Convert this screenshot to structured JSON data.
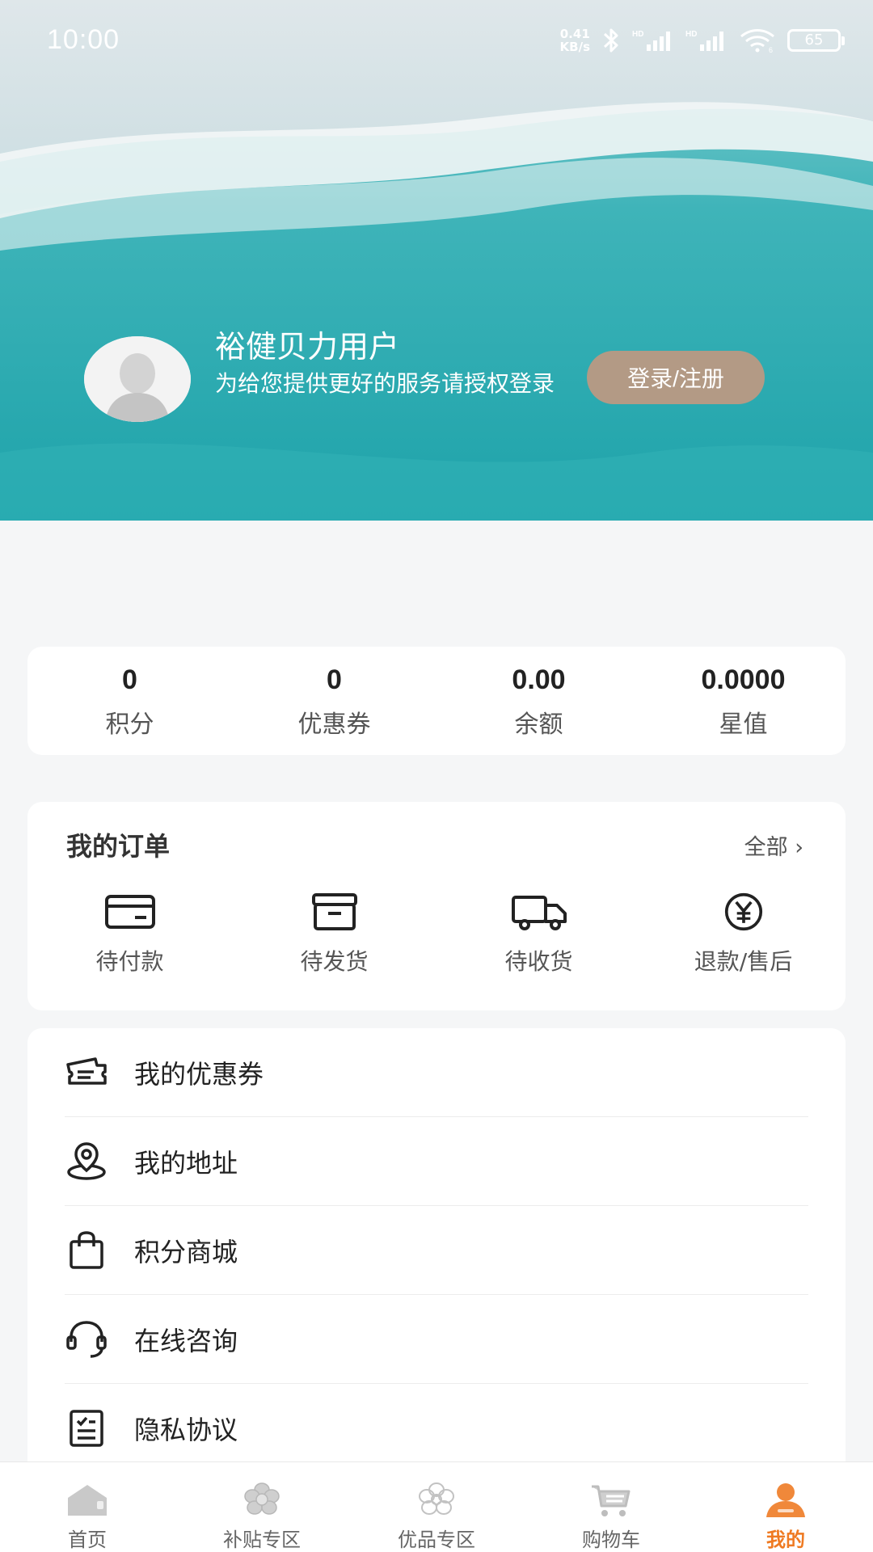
{
  "status_bar": {
    "time": "10:00",
    "net_speed_value": "0.41",
    "net_speed_unit": "KB/s",
    "battery": "65"
  },
  "profile": {
    "name": "裕健贝力用户",
    "desc": "为给您提供更好的服务请授权登录",
    "login_label": "登录/注册"
  },
  "stats": [
    {
      "value": "0",
      "label": "积分"
    },
    {
      "value": "0",
      "label": "优惠券"
    },
    {
      "value": "0.00",
      "label": "余额"
    },
    {
      "value": "0.0000",
      "label": "星值"
    }
  ],
  "orders": {
    "title": "我的订单",
    "all_label": "全部 ›",
    "items": [
      {
        "label": "待付款",
        "icon": "card-icon"
      },
      {
        "label": "待发货",
        "icon": "box-icon"
      },
      {
        "label": "待收货",
        "icon": "truck-icon"
      },
      {
        "label": "退款/售后",
        "icon": "yuan-icon"
      }
    ]
  },
  "menu": [
    {
      "label": "我的优惠券",
      "icon": "ticket-icon"
    },
    {
      "label": "我的地址",
      "icon": "location-icon"
    },
    {
      "label": "积分商城",
      "icon": "bag-icon"
    },
    {
      "label": "在线咨询",
      "icon": "headset-icon"
    },
    {
      "label": "隐私协议",
      "icon": "checklist-icon"
    }
  ],
  "tabbar": [
    {
      "label": "首页",
      "icon": "home-icon"
    },
    {
      "label": "补贴专区",
      "icon": "flower-icon"
    },
    {
      "label": "优品专区",
      "icon": "flower-outline-icon"
    },
    {
      "label": "购物车",
      "icon": "cart-icon"
    },
    {
      "label": "我的",
      "icon": "user-icon",
      "active": true
    }
  ],
  "colors": {
    "accent": "#ef7a22",
    "login_button": "#b39a85",
    "sea": "#25aab0"
  }
}
